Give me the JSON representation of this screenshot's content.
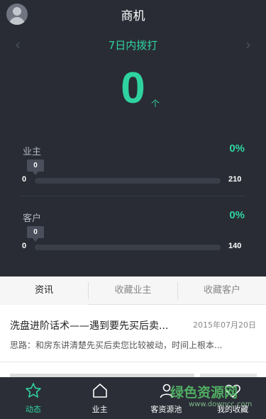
{
  "header": {
    "title": "商机"
  },
  "period": {
    "label": "7日内拨打",
    "prev_icon": "chevron-left-icon",
    "next_icon": "chevron-right-icon"
  },
  "total": {
    "value": "0",
    "unit": "个"
  },
  "stats": [
    {
      "label": "业主",
      "percent": "0%",
      "current": "0",
      "min": "0",
      "max": "210"
    },
    {
      "label": "客户",
      "percent": "0%",
      "current": "0",
      "min": "0",
      "max": "140"
    }
  ],
  "tabs": [
    {
      "label": "资讯",
      "active": true
    },
    {
      "label": "收藏业主",
      "active": false
    },
    {
      "label": "收藏客户",
      "active": false
    }
  ],
  "news": [
    {
      "title": "洗盘进阶话术——遇到要先买后卖...",
      "date": "2015年07月20日",
      "summary": "思路：和房东讲清楚先买后卖您比较被动，时间上根本..."
    }
  ],
  "bottom_nav": [
    {
      "label": "动态",
      "icon": "star-icon",
      "active": true
    },
    {
      "label": "业主",
      "icon": "home-icon",
      "active": false
    },
    {
      "label": "客资源池",
      "icon": "person-icon",
      "active": false
    },
    {
      "label": "我的收藏",
      "icon": "heart-icon",
      "active": false
    }
  ],
  "watermark": {
    "text": "绿色资源网",
    "url": "www.downcc.com"
  },
  "colors": {
    "accent": "#2fd3a0",
    "panel": "#292c35",
    "nav_bg": "#2b2e37"
  }
}
